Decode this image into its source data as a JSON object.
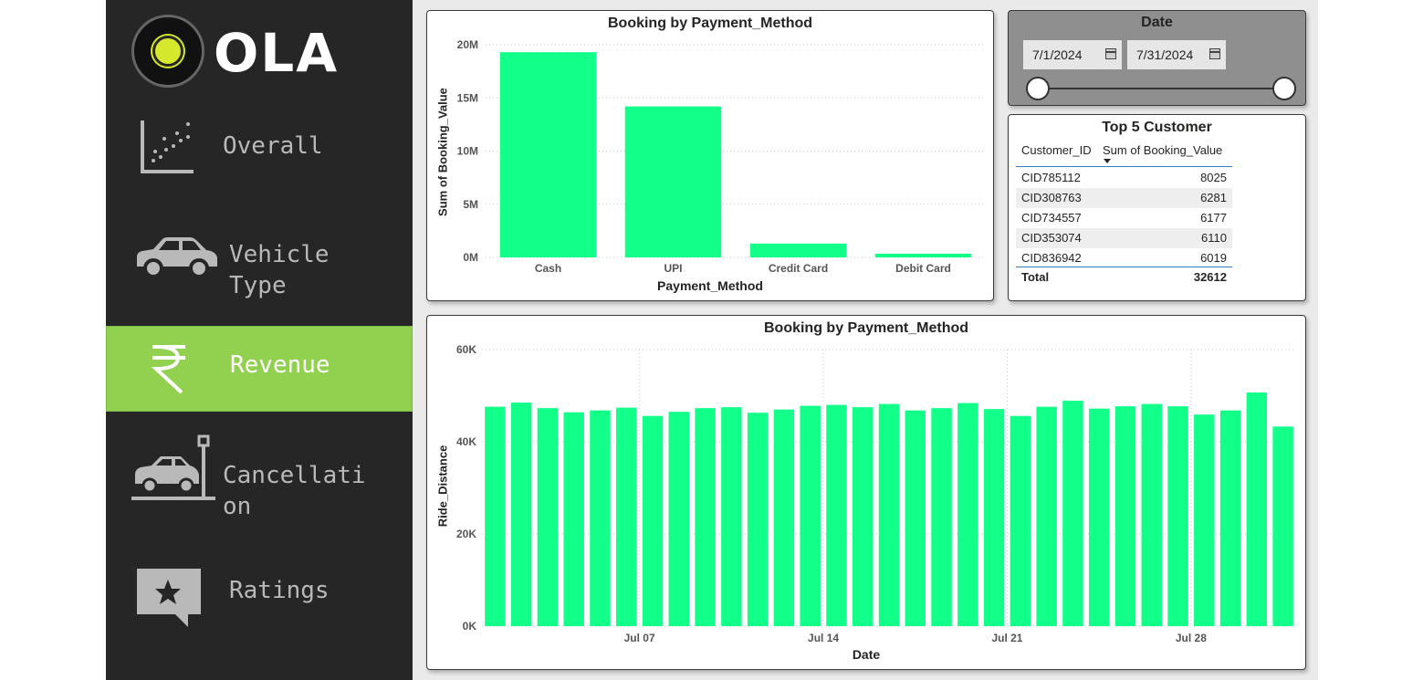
{
  "sidebar": {
    "logo_text": "OLA",
    "items": [
      {
        "label": "Overall",
        "icon": "scatter-chart-icon"
      },
      {
        "label": "Vehicle\nType",
        "icon": "car-icon"
      },
      {
        "label": "Revenue",
        "icon": "rupee-icon",
        "active": true
      },
      {
        "label": "Cancellati\non",
        "icon": "car-crash-icon"
      },
      {
        "label": "Ratings",
        "icon": "star-speech-bubble-icon"
      }
    ],
    "active_color": "#92d050",
    "background": "#262626"
  },
  "payment_chart": {
    "title": "Booking by Payment_Method",
    "xlabel": "Payment_Method",
    "ylabel": "Sum of Booking_Value",
    "yticks": [
      "0M",
      "5M",
      "10M",
      "15M",
      "20M"
    ]
  },
  "date_slicer": {
    "title": "Date",
    "start_date": "7/1/2024",
    "end_date": "7/31/2024"
  },
  "top_customers": {
    "title": "Top 5 Customer",
    "col1": "Customer_ID",
    "col2": "Sum of Booking_Value",
    "rows": [
      {
        "id": "CID785112",
        "value": "8025"
      },
      {
        "id": "CID308763",
        "value": "6281"
      },
      {
        "id": "CID734557",
        "value": "6177"
      },
      {
        "id": "CID353074",
        "value": "6110"
      },
      {
        "id": "CID836942",
        "value": "6019"
      }
    ],
    "total_label": "Total",
    "total_value": "32612"
  },
  "distance_chart": {
    "title": "Booking by Payment_Method",
    "xlabel": "Date",
    "ylabel": "Ride_Distance",
    "yticks": [
      "0K",
      "20K",
      "40K",
      "60K"
    ],
    "xticks": [
      "Jul 07",
      "Jul 14",
      "Jul 21",
      "Jul 28"
    ]
  },
  "bar_color": "#12ff8a",
  "chart_data": [
    {
      "type": "bar",
      "title": "Booking by Payment_Method",
      "xlabel": "Payment_Method",
      "ylabel": "Sum of Booking_Value",
      "categories": [
        "Cash",
        "UPI",
        "Credit Card",
        "Debit Card"
      ],
      "values": [
        19300000,
        14200000,
        1300000,
        350000
      ],
      "ylim": [
        0,
        20000000
      ],
      "grid": true
    },
    {
      "type": "bar",
      "title": "Booking by Payment_Method",
      "xlabel": "Date",
      "ylabel": "Ride_Distance",
      "categories": [
        "2024-07-01",
        "2024-07-02",
        "2024-07-03",
        "2024-07-04",
        "2024-07-05",
        "2024-07-06",
        "2024-07-07",
        "2024-07-08",
        "2024-07-09",
        "2024-07-10",
        "2024-07-11",
        "2024-07-12",
        "2024-07-13",
        "2024-07-14",
        "2024-07-15",
        "2024-07-16",
        "2024-07-17",
        "2024-07-18",
        "2024-07-19",
        "2024-07-20",
        "2024-07-21",
        "2024-07-22",
        "2024-07-23",
        "2024-07-24",
        "2024-07-25",
        "2024-07-26",
        "2024-07-27",
        "2024-07-28",
        "2024-07-29",
        "2024-07-30",
        "2024-07-31"
      ],
      "values": [
        47600,
        48500,
        47300,
        46400,
        46800,
        47400,
        45600,
        46500,
        47300,
        47500,
        46300,
        47000,
        47800,
        48000,
        47500,
        48200,
        46800,
        47300,
        48400,
        47100,
        45600,
        47600,
        48900,
        47200,
        47700,
        48200,
        47700,
        45900,
        46800,
        50700,
        43300
      ],
      "xticks": [
        "Jul 07",
        "Jul 14",
        "Jul 21",
        "Jul 28"
      ],
      "ylim": [
        0,
        60000
      ],
      "grid": true
    }
  ]
}
